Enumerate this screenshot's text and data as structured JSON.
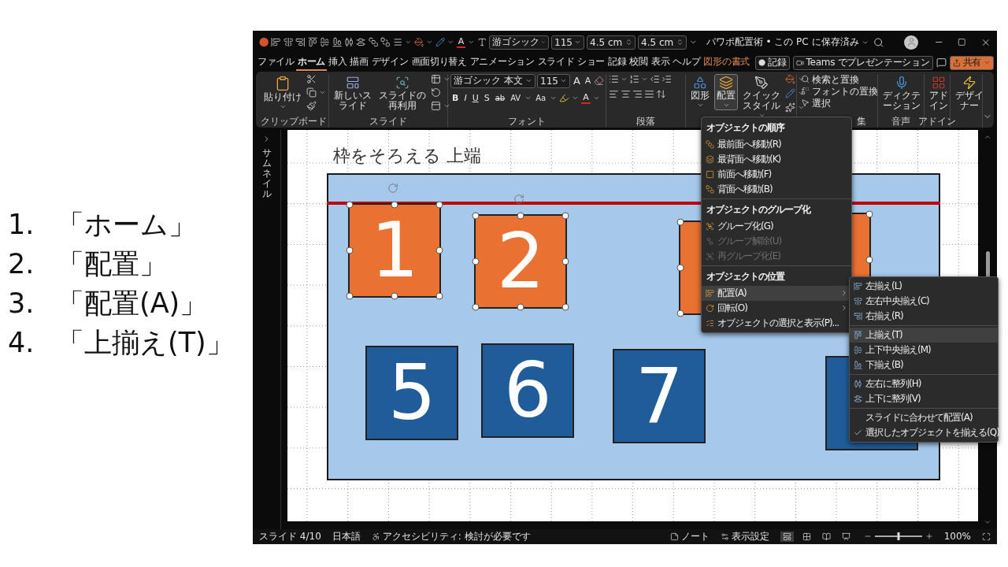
{
  "steps": [
    {
      "number": "1.",
      "text": "「ホーム」"
    },
    {
      "number": "2.",
      "text": "「配置」"
    },
    {
      "number": "3.",
      "text": "「配置(A)」"
    },
    {
      "number": "4.",
      "text": "「上揃え(T)」"
    }
  ],
  "title_bar": {
    "font": "游ゴシック",
    "font_size": "115",
    "shape_width": "4.5 cm",
    "shape_height": "4.5 cm",
    "font_color_glyph": "A",
    "document_title": "パワポ配置術 • この PC に保存済み"
  },
  "ribbon_tabs": [
    {
      "label": "ファイル",
      "selected": false,
      "kind": "standard"
    },
    {
      "label": "ホーム",
      "selected": true,
      "kind": "standard"
    },
    {
      "label": "挿入",
      "selected": false,
      "kind": "standard"
    },
    {
      "label": "描画",
      "selected": false,
      "kind": "standard"
    },
    {
      "label": "デザイン",
      "selected": false,
      "kind": "standard"
    },
    {
      "label": "画面切り替え",
      "selected": false,
      "kind": "standard"
    },
    {
      "label": "アニメーション",
      "selected": false,
      "kind": "standard"
    },
    {
      "label": "スライド ショー",
      "selected": false,
      "kind": "standard"
    },
    {
      "label": "記録",
      "selected": false,
      "kind": "standard"
    },
    {
      "label": "校閲",
      "selected": false,
      "kind": "standard"
    },
    {
      "label": "表示",
      "selected": false,
      "kind": "standard"
    },
    {
      "label": "ヘルプ",
      "selected": false,
      "kind": "standard"
    },
    {
      "label": "図形の書式",
      "selected": false,
      "kind": "contextual"
    }
  ],
  "ribbon_actions": {
    "record": "記録",
    "teams": "Teams でプレゼンテーション",
    "share": "共有"
  },
  "ribbon_groups": [
    {
      "kind": "clipboard",
      "label": "クリップボード",
      "buttons": [
        {
          "label": "貼り付け"
        }
      ]
    },
    {
      "kind": "slides",
      "label": "スライド",
      "buttons": [
        {
          "label": "新しいスライド"
        },
        {
          "label": "スライドの再利用"
        }
      ]
    },
    {
      "kind": "font",
      "label": "フォント",
      "font": "游ゴシック 本文",
      "size": "115",
      "glyphs": [
        "A",
        "A",
        "B",
        "I",
        "U",
        "S",
        "ab",
        "AV",
        "Aa",
        "A"
      ]
    },
    {
      "kind": "paragraph",
      "label": "段落"
    },
    {
      "kind": "drawing",
      "buttons": [
        {
          "label": "図形",
          "pressed": false
        },
        {
          "label": "配置",
          "pressed": true
        },
        {
          "label": "クイックスタイル",
          "pressed": false
        }
      ]
    },
    {
      "kind": "editing",
      "label": "集",
      "buttons": [
        {
          "label": "検索と置換"
        },
        {
          "label": "フォントの置換"
        },
        {
          "label": "選択"
        }
      ]
    },
    {
      "kind": "voice",
      "label": "音声",
      "buttons": [
        {
          "label": "ディクテーション"
        }
      ]
    },
    {
      "kind": "addin",
      "label": "アドイン",
      "buttons": [
        {
          "label": "アドイン"
        }
      ]
    },
    {
      "kind": "designer",
      "buttons": [
        {
          "label": "デザイナー"
        }
      ]
    }
  ],
  "thumbnail_pane": {
    "label": "サムネイル"
  },
  "slide": {
    "title": "枠をそろえる 上端",
    "shapes": [
      {
        "label": "1",
        "color": "#e97132",
        "selected": true
      },
      {
        "label": "2",
        "color": "#e97132",
        "selected": true
      },
      {
        "color": "#e97132",
        "selected": true
      },
      {
        "color": "#e97132",
        "selected": true
      },
      {
        "label": "5",
        "color": "#1f5c99",
        "selected": false
      },
      {
        "label": "6",
        "color": "#1f5c99",
        "selected": false
      },
      {
        "label": "7",
        "color": "#1f5c99",
        "selected": false
      },
      {
        "color": "#1f5c99",
        "selected": false
      }
    ]
  },
  "arrange_menu": {
    "sections": [
      {
        "header": "オブジェクトの順序",
        "items": [
          {
            "label": "最前面へ移動(R)",
            "disabled": false,
            "selected": false,
            "submenu": false
          },
          {
            "label": "最背面へ移動(K)",
            "disabled": false,
            "selected": false,
            "submenu": false
          },
          {
            "label": "前面へ移動(F)",
            "disabled": false,
            "selected": false,
            "submenu": false
          },
          {
            "label": "背面へ移動(B)",
            "disabled": false,
            "selected": false,
            "submenu": false
          }
        ]
      },
      {
        "header": "オブジェクトのグループ化",
        "items": [
          {
            "label": "グループ化(G)",
            "disabled": false,
            "selected": false,
            "submenu": false
          },
          {
            "label": "グループ解除(U)",
            "disabled": true,
            "selected": false,
            "submenu": false
          },
          {
            "label": "再グループ化(E)",
            "disabled": true,
            "selected": false,
            "submenu": false
          }
        ]
      },
      {
        "header": "オブジェクトの位置",
        "items": [
          {
            "label": "配置(A)",
            "disabled": false,
            "selected": true,
            "submenu": true
          },
          {
            "label": "回転(O)",
            "disabled": false,
            "selected": false,
            "submenu": true
          },
          {
            "label": "オブジェクトの選択と表示(P)...",
            "disabled": false,
            "selected": false,
            "submenu": false
          }
        ]
      }
    ]
  },
  "align_submenu": {
    "groups": [
      {
        "items": [
          {
            "label": "左揃え(L)",
            "selected": false,
            "checked": false
          },
          {
            "label": "左右中央揃え(C)",
            "selected": false,
            "checked": false
          },
          {
            "label": "右揃え(R)",
            "selected": false,
            "checked": false
          }
        ]
      },
      {
        "items": [
          {
            "label": "上揃え(T)",
            "selected": true,
            "checked": false
          },
          {
            "label": "上下中央揃え(M)",
            "selected": false,
            "checked": false
          },
          {
            "label": "下揃え(B)",
            "selected": false,
            "checked": false
          }
        ]
      },
      {
        "items": [
          {
            "label": "左右に整列(H)",
            "selected": false,
            "checked": false
          },
          {
            "label": "上下に整列(V)",
            "selected": false,
            "checked": false
          }
        ]
      },
      {
        "items": [
          {
            "label": "スライドに合わせて配置(A)",
            "selected": false,
            "checked": false
          },
          {
            "label": "選択したオブジェクトを揃える(Q)",
            "selected": false,
            "checked": true
          }
        ]
      }
    ]
  },
  "status_bar": {
    "slide": "スライド 4/10",
    "language": "日本語",
    "accessibility": "アクセシビリティ: 検討が必要です",
    "notes": "ノート",
    "display_settings": "表示設定",
    "views": [
      {
        "selected": true
      },
      {
        "selected": false
      },
      {
        "selected": false
      },
      {
        "selected": false
      }
    ],
    "zoom": {
      "level": 0.5,
      "reading": "100%"
    }
  }
}
